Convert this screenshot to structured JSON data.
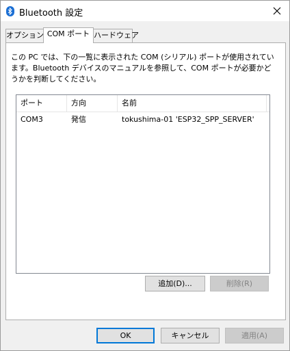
{
  "window": {
    "title": "Bluetooth 設定",
    "icon": "bluetooth-icon",
    "close_glyph": "✕"
  },
  "tabs": [
    {
      "label": "オプション",
      "active": false
    },
    {
      "label": "COM ポート",
      "active": true
    },
    {
      "label": "ハードウェア",
      "active": false
    }
  ],
  "description": "この PC では、下の一覧に表示された COM (シリアル) ポートが使用されています。Bluetooth デバイスのマニュアルを参照して、COM ポートが必要かどうかを判断してください。",
  "list": {
    "columns": [
      "ポート",
      "方向",
      "名前"
    ],
    "rows": [
      {
        "port": "COM3",
        "direction": "発信",
        "name": "tokushima-01 'ESP32_SPP_SERVER'"
      }
    ]
  },
  "buttons": {
    "add": "追加(D)...",
    "remove": "削除(R)",
    "ok": "OK",
    "cancel": "キャンセル",
    "apply": "適用(A)"
  },
  "colors": {
    "accent": "#0078d7",
    "bluetooth": "#1b6fd4",
    "disabled_text": "#838383"
  }
}
